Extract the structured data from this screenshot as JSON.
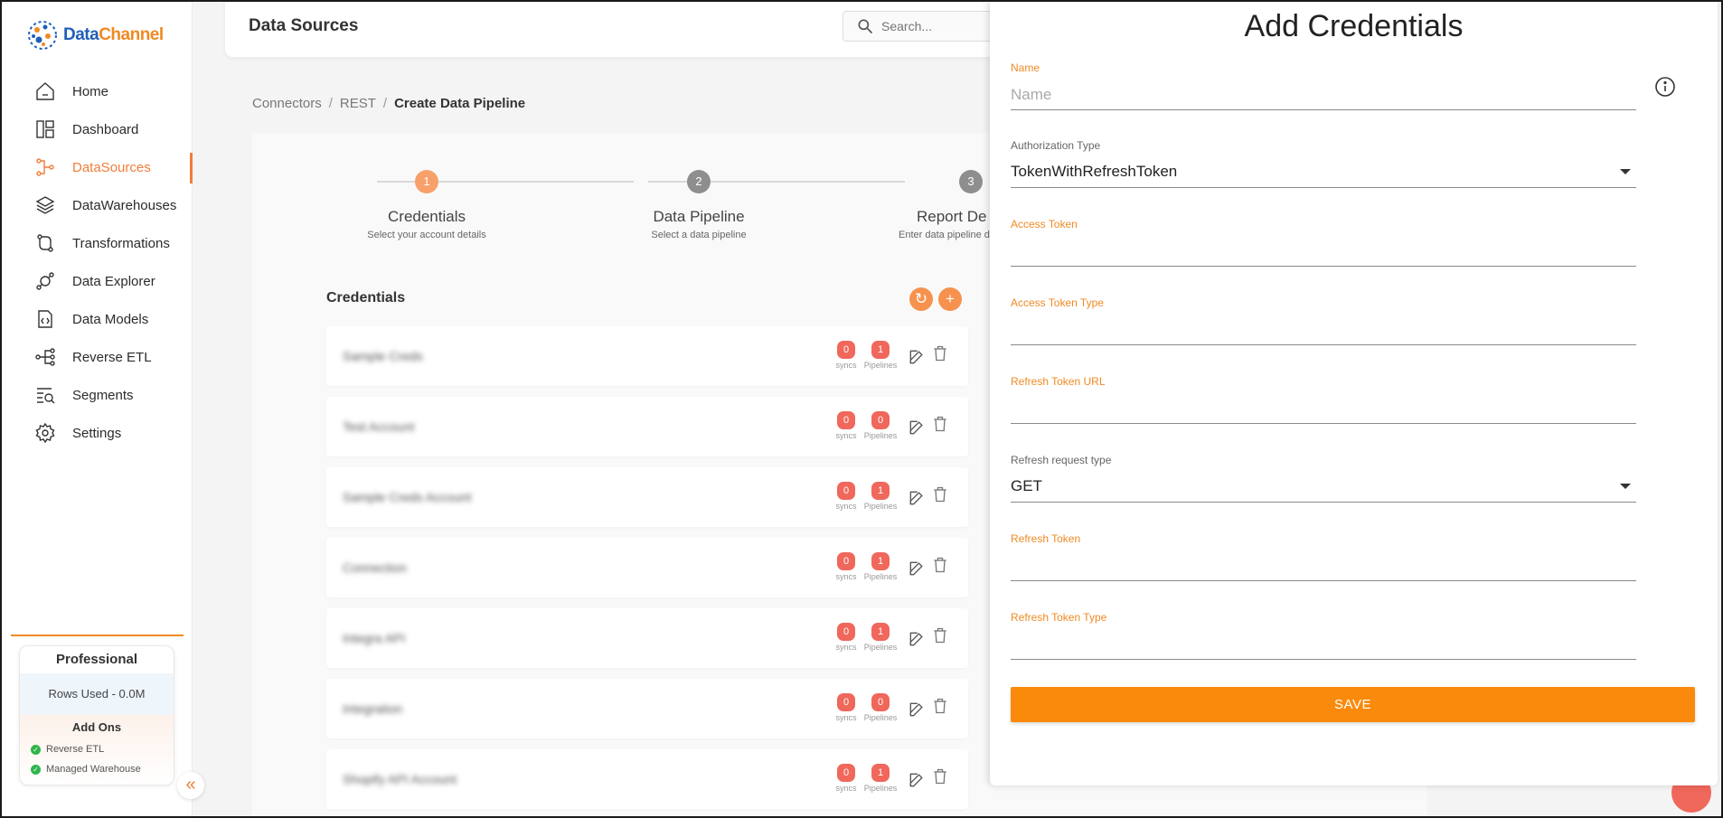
{
  "app": {
    "brand_part1": "Data",
    "brand_part2": "Channel"
  },
  "colors": {
    "accent": "#f08a24",
    "active_nav": "#f07d3a",
    "pill": "#f0675c",
    "save": "#f98a0c"
  },
  "sidebar": {
    "items": [
      {
        "label": "Home",
        "icon": "home-icon"
      },
      {
        "label": "Dashboard",
        "icon": "dashboard-icon"
      },
      {
        "label": "DataSources",
        "icon": "datasources-icon",
        "active": true
      },
      {
        "label": "DataWarehouses",
        "icon": "datawarehouses-icon"
      },
      {
        "label": "Transformations",
        "icon": "transformations-icon"
      },
      {
        "label": "Data Explorer",
        "icon": "data-explorer-icon"
      },
      {
        "label": "Data Models",
        "icon": "data-models-icon"
      },
      {
        "label": "Reverse ETL",
        "icon": "reverse-etl-icon"
      },
      {
        "label": "Segments",
        "icon": "segments-icon"
      },
      {
        "label": "Settings",
        "icon": "settings-icon"
      }
    ],
    "plan": {
      "title": "Professional",
      "rows_used": "Rows Used - 0.0M",
      "addons_title": "Add Ons",
      "addons": [
        "Reverse ETL",
        "Managed Warehouse"
      ]
    },
    "collapse_label": "«"
  },
  "header": {
    "title": "Data Sources",
    "search_placeholder": "Search..."
  },
  "breadcrumb": {
    "items": [
      "Connectors",
      "REST"
    ],
    "current": "Create Data Pipeline",
    "sep": "/"
  },
  "stepper": {
    "steps": [
      {
        "num": "1",
        "title": "Credentials",
        "sub": "Select your account details",
        "active": true
      },
      {
        "num": "2",
        "title": "Data Pipeline",
        "sub": "Select a data pipeline"
      },
      {
        "num": "3",
        "title": "Report De",
        "sub": "Enter data pipeline d"
      }
    ]
  },
  "credentials": {
    "title": "Credentials",
    "refresh_label": "↻",
    "add_label": "+",
    "sync_label": "syncs",
    "pipeline_label": "Pipelines",
    "rows": [
      {
        "name": "Sample Creds",
        "syncs": "0",
        "pipelines": "1"
      },
      {
        "name": "Test Account",
        "syncs": "0",
        "pipelines": "0"
      },
      {
        "name": "Sample Creds Account",
        "syncs": "0",
        "pipelines": "1"
      },
      {
        "name": "Connection",
        "syncs": "0",
        "pipelines": "1"
      },
      {
        "name": "Integra API",
        "syncs": "0",
        "pipelines": "1"
      },
      {
        "name": "Integration",
        "syncs": "0",
        "pipelines": "0"
      },
      {
        "name": "Shopify API Account",
        "syncs": "0",
        "pipelines": "1"
      }
    ]
  },
  "drawer": {
    "title": "Add Credentials",
    "name_label": "Name",
    "name_placeholder": "Name",
    "auth_label": "Authorization Type",
    "auth_value": "TokenWithRefreshToken",
    "access_token_label": "Access Token",
    "access_token_type_label": "Access Token Type",
    "refresh_url_label": "Refresh Token URL",
    "refresh_req_label": "Refresh request type",
    "refresh_req_value": "GET",
    "refresh_token_label": "Refresh Token",
    "refresh_token_type_label": "Refresh Token Type",
    "save_label": "SAVE"
  }
}
